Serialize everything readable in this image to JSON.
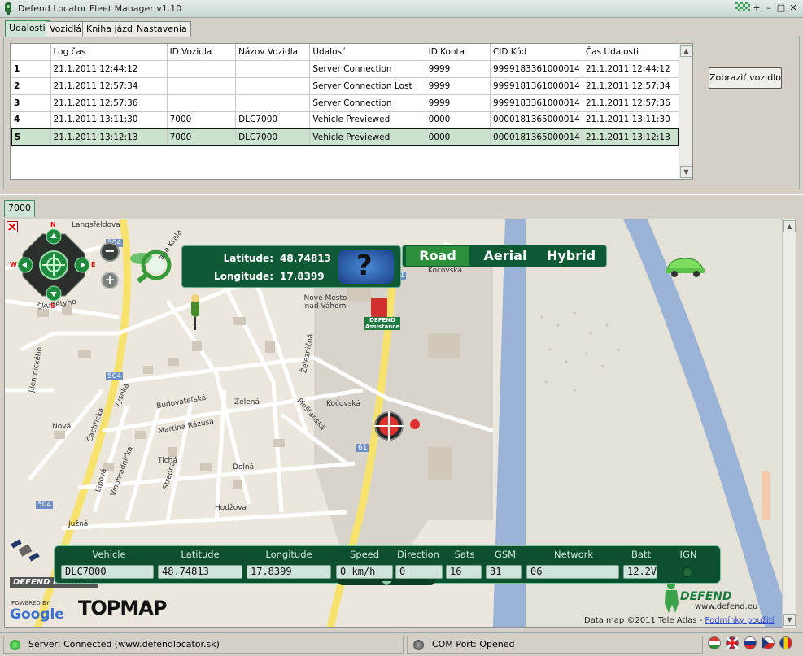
{
  "window": {
    "title": "Defend Locator Fleet Manager v1.10"
  },
  "tabs": [
    "Udalosti",
    "Vozidlá",
    "Kniha jázd",
    "Nastavenia"
  ],
  "grid": {
    "columns": [
      "Log čas",
      "ID Vozidla",
      "Názov Vozidla",
      "Udalosť",
      "ID Konta",
      "CID Kód",
      "Čas Udalosti"
    ],
    "rows": [
      {
        "n": "1",
        "log": "21.1.2011 12:44:12",
        "vid": "",
        "vname": "",
        "event": "Server Connection",
        "acct": "9999",
        "cid": "9999183361000014",
        "time": "21.1.2011 12:44:12"
      },
      {
        "n": "2",
        "log": "21.1.2011 12:57:34",
        "vid": "",
        "vname": "",
        "event": "Server Connection Lost",
        "acct": "9999",
        "cid": "9999181361000014",
        "time": "21.1.2011 12:57:34"
      },
      {
        "n": "3",
        "log": "21.1.2011 12:57:36",
        "vid": "",
        "vname": "",
        "event": "Server Connection",
        "acct": "9999",
        "cid": "9999183361000014",
        "time": "21.1.2011 12:57:36"
      },
      {
        "n": "4",
        "log": "21.1.2011 13:11:30",
        "vid": "7000",
        "vname": "DLC7000",
        "event": "Vehicle Previewed",
        "acct": "0000",
        "cid": "0000181365000014",
        "time": "21.1.2011 13:11:30"
      },
      {
        "n": "5",
        "log": "21.1.2011 13:12:13",
        "vid": "7000",
        "vname": "DLC7000",
        "event": "Vehicle Previewed",
        "acct": "0000",
        "cid": "0000181365000014",
        "time": "21.1.2011 13:12:13"
      }
    ]
  },
  "show_vehicle_button": "Zobraziť vozidlo",
  "map_tab": "7000",
  "map": {
    "coords": {
      "lat_label": "Latitude:",
      "lat": "48.74813",
      "lon_label": "Longitude:",
      "lon": "17.8399"
    },
    "map_types": [
      "Road",
      "Aerial",
      "Hybrid"
    ],
    "active_map_type": "Road",
    "compass": {
      "n": "N",
      "s": "S",
      "e": "E",
      "w": "W"
    },
    "street_labels": [
      "Langsfeldova",
      "Frana Krala",
      "Škultétyho",
      "Jilemnického",
      "Čachtická",
      "Vysoká",
      "Nová",
      "Budovateľská",
      "Martina Rázusa",
      "Zelená",
      "Kočovská",
      "Piešťanská",
      "Tichá",
      "Lipová",
      "Vinohradnícka",
      "Južná",
      "Hodžova",
      "Dolná",
      "Stredná",
      "Kočovská",
      "Nové Mesto nad Váhom",
      "Železničná"
    ],
    "road_badges": [
      "504",
      "504",
      "504",
      "61",
      "61"
    ],
    "defend_assistance": "DEFEND Assistance",
    "attribution": "Data map ©2011 Tele Atlas - ",
    "attribution_link": "Podmínky použití",
    "defend_brand": "DEFEND",
    "defend_url": "www.defend.eu",
    "logos": {
      "locator": "DEFEND LOCATOR",
      "powered": "POWERED BY",
      "google": "Google",
      "topmap": "TOPMAP"
    }
  },
  "vehicle_info": {
    "headers": [
      "Vehicle",
      "Latitude",
      "Longitude",
      "Speed",
      "Direction",
      "Sats",
      "GSM",
      "Network",
      "Batt",
      "IGN"
    ],
    "values": {
      "vehicle": "DLC7000",
      "lat": "48.74813",
      "lon": "17.8399",
      "speed": "0 km/h",
      "direction": "0",
      "sats": "16",
      "gsm": "31",
      "network": "06",
      "batt": "12.2V"
    }
  },
  "status": {
    "server": "Server: Connected (www.defendlocator.sk)",
    "com": "COM Port: Opened"
  },
  "colors": {
    "accent": "#0e5a34",
    "selected_row": "#cbe3cc",
    "server_ok": "#2a9d2a"
  }
}
